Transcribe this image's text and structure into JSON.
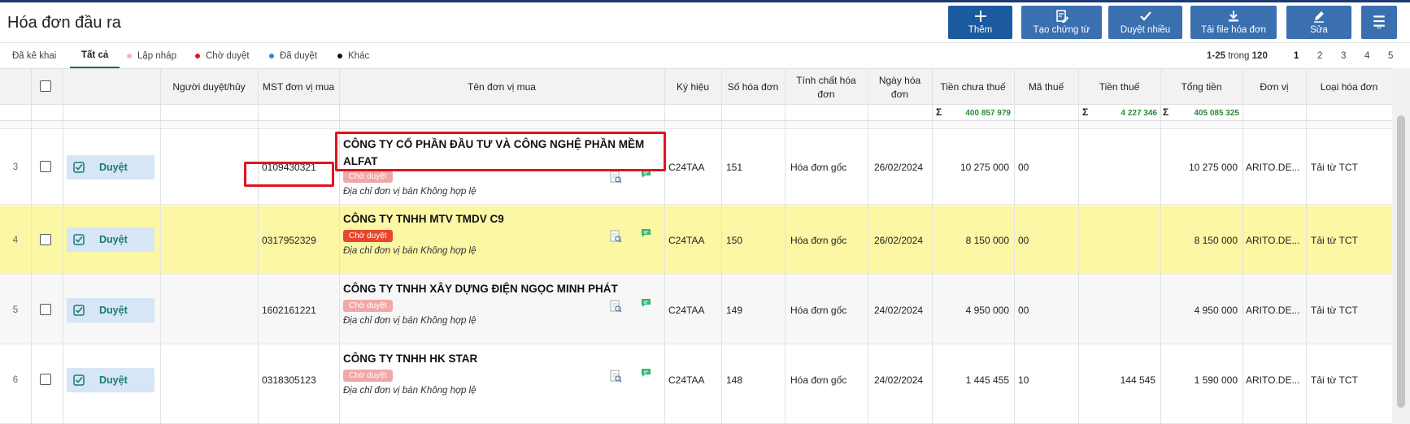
{
  "header": {
    "title": "Hóa đơn đầu ra",
    "buttons": [
      {
        "label": "Thêm",
        "icon": "plus-icon"
      },
      {
        "label": "Tạo chứng từ",
        "icon": "document-edit-icon"
      },
      {
        "label": "Duyệt nhiều",
        "icon": "check-icon"
      },
      {
        "label": "Tải file hóa đơn",
        "icon": "download-icon"
      },
      {
        "label": "Sửa",
        "icon": "pencil-icon"
      },
      {
        "label": "",
        "icon": "menu-icon"
      }
    ]
  },
  "tabs": [
    {
      "label": "Đã kê khai"
    },
    {
      "label": "Tất cả"
    },
    {
      "label": "Lập nháp",
      "dot": "#f3b6c6"
    },
    {
      "label": "Chờ duyệt",
      "dot": "#e0141e"
    },
    {
      "label": "Đã duyệt",
      "dot": "#3f7fd0"
    },
    {
      "label": "Khác",
      "dot": "#111111"
    }
  ],
  "pagination": {
    "range": "1-25",
    "of": "trong",
    "total": "120",
    "pages": [
      "1",
      "2",
      "3",
      "4",
      "5"
    ],
    "current": "1"
  },
  "columns": [
    "Người duyệt/hủy",
    "MST đơn vị mua",
    "Tên đơn vị mua",
    "Ký hiệu",
    "Số hóa đơn",
    "Tính chất hóa đơn",
    "Ngày hóa đơn",
    "Tiền chưa thuế",
    "Mã thuế",
    "Tiền thuế",
    "Tổng tiền",
    "Đơn vị",
    "Loại hóa đơn"
  ],
  "totals": {
    "subtotal": "400 857 979",
    "tax": "4 227 346",
    "total": "405 085 325"
  },
  "approve_label": "Duyệt",
  "rows": [
    {
      "num": "3",
      "mst": "0109430321",
      "name": "CÔNG TY CỔ PHẦN ĐẦU TƯ VÀ CÔNG NGHỆ PHẦN MỀM ALFAT",
      "status": "Chờ duyệt",
      "note": "Địa chỉ đơn vị bán Không hợp lệ",
      "symbol": "C24TAA",
      "invoice_no": "151",
      "nature": "Hóa đơn gốc",
      "date": "26/02/2024",
      "subtotal": "10 275 000",
      "tax_code": "00",
      "tax": "",
      "total": "10 275 000",
      "unit": "ARITO.DE...",
      "type": "Tải từ TCT"
    },
    {
      "num": "4",
      "mst": "0317952329",
      "name": "CÔNG TY TNHH MTV TMDV C9",
      "status": "Chờ duyệt",
      "note": "Địa chỉ đơn vị bán Không hợp lệ",
      "symbol": "C24TAA",
      "invoice_no": "150",
      "nature": "Hóa đơn gốc",
      "date": "26/02/2024",
      "subtotal": "8 150 000",
      "tax_code": "00",
      "tax": "",
      "total": "8 150 000",
      "unit": "ARITO.DE...",
      "type": "Tải từ TCT"
    },
    {
      "num": "5",
      "mst": "1602161221",
      "name": "CÔNG TY TNHH XÂY DỰNG ĐIỆN NGỌC MINH PHÁT",
      "status": "Chờ duyệt",
      "note": "Địa chỉ đơn vị bán Không hợp lệ",
      "symbol": "C24TAA",
      "invoice_no": "149",
      "nature": "Hóa đơn gốc",
      "date": "24/02/2024",
      "subtotal": "4 950 000",
      "tax_code": "00",
      "tax": "",
      "total": "4 950 000",
      "unit": "ARITO.DE...",
      "type": "Tải từ TCT"
    },
    {
      "num": "6",
      "mst": "0318305123",
      "name": "CÔNG TY TNHH HK STAR",
      "status": "Chờ duyệt",
      "note": "Địa chỉ đơn vị bán Không hợp lệ",
      "symbol": "C24TAA",
      "invoice_no": "148",
      "nature": "Hóa đơn gốc",
      "date": "24/02/2024",
      "subtotal": "1 445 455",
      "tax_code": "10",
      "tax": "144 545",
      "total": "1 590 000",
      "unit": "ARITO.DE...",
      "type": "Tải từ TCT"
    }
  ]
}
